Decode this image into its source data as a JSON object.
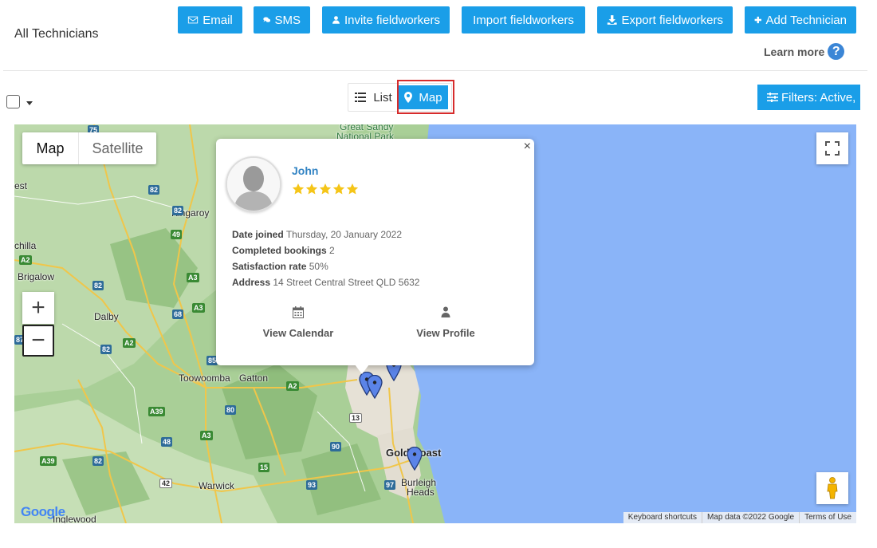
{
  "header": {
    "title": "All Technicians",
    "buttons": {
      "email": "Email",
      "sms": "SMS",
      "invite": "Invite fieldworkers",
      "import": "Import fieldworkers",
      "export": "Export fieldworkers",
      "add": "Add Technician"
    },
    "learn_more": "Learn more",
    "help_glyph": "?"
  },
  "toolbar": {
    "view_list": "List",
    "view_map": "Map",
    "active_view": "Map",
    "filters": "Filters: Active,"
  },
  "map": {
    "type_map": "Map",
    "type_satellite": "Satellite",
    "zoom_in": "+",
    "zoom_out": "−",
    "attribution": {
      "shortcuts": "Keyboard shortcuts",
      "data": "Map data ©2022 Google",
      "terms": "Terms of Use"
    },
    "logo": "Google",
    "places": {
      "great_sandy_1": "Great Sandy",
      "great_sandy_2": "National Park",
      "kingaroy": "Kingaroy",
      "chilla": "chilla",
      "brigalow": "Brigalow",
      "dalby": "Dalby",
      "toowoomba": "Toowoomba",
      "gatton": "Gatton",
      "warwick": "Warwick",
      "gold_coast": "Gold Coast",
      "burleigh_1": "Burleigh",
      "burleigh_2": "Heads",
      "inglewood": "Inglewood",
      "est": "est"
    },
    "shields": [
      "75",
      "82",
      "49",
      "82",
      "A2",
      "A3",
      "82",
      "A3",
      "68",
      "A2",
      "82",
      "85",
      "A2",
      "A39",
      "80",
      "A3",
      "48",
      "A39",
      "82",
      "42",
      "15",
      "93",
      "90",
      "13",
      "97",
      "87"
    ]
  },
  "popup": {
    "close": "×",
    "name": "John",
    "rating": 5,
    "details": {
      "date_joined_label": "Date joined",
      "date_joined_value": "Thursday, 20 January 2022",
      "bookings_label": "Completed bookings",
      "bookings_value": "2",
      "satisfaction_label": "Satisfaction rate",
      "satisfaction_value": "50%",
      "address_label": "Address",
      "address_value": "14 Street Central Street QLD 5632"
    },
    "actions": {
      "calendar": "View Calendar",
      "profile": "View Profile"
    }
  },
  "colors": {
    "primary": "#1a9ee8",
    "highlight": "#d62c2c",
    "star": "#f5c518",
    "marker": "#5b84e8",
    "water": "#8ab4f8",
    "land": "#a9cf97"
  }
}
